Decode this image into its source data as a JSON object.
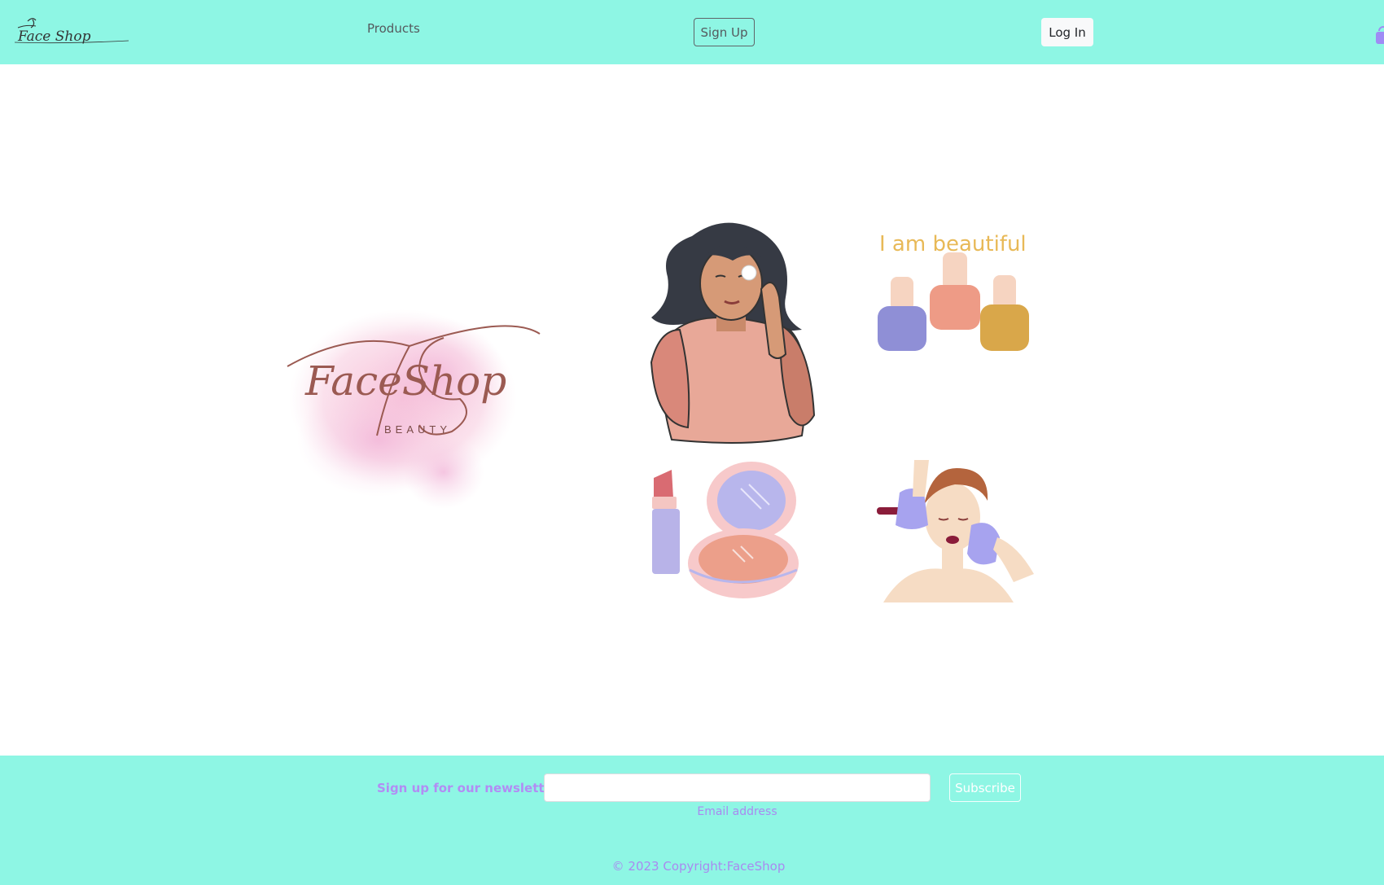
{
  "navbar": {
    "brand_text": "Face Shop",
    "products_label": "Products",
    "signup_label": "Sign Up",
    "login_label": "Log In",
    "cart_icon": "shopping-bag-icon"
  },
  "hero": {
    "logo_title": "FaceShop",
    "logo_subtitle": "BEAUTY",
    "sticker_caption": "I am beautiful",
    "images": [
      "woman-skincare-illustration",
      "nail-polish-illustration",
      "lipstick-compact-illustration",
      "makeup-application-illustration"
    ]
  },
  "footer": {
    "newsletter_label": "Sign up for our newsletter",
    "email_value": "",
    "email_hint": "Email address",
    "subscribe_label": "Subscribe",
    "copyright": "© 2023 Copyright:FaceShop"
  },
  "colors": {
    "accent": "#8ef6e4",
    "purple": "#b28cf4",
    "logo_brown": "#9b5a52"
  }
}
